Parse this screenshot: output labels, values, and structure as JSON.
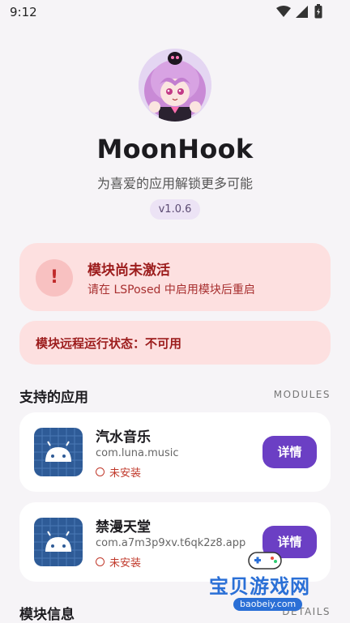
{
  "status_bar": {
    "time": "9:12"
  },
  "header": {
    "app_title": "MoonHook",
    "subtitle": "为喜爱的应用解锁更多可能",
    "version": "v1.0.6"
  },
  "warning": {
    "icon": "!",
    "title": "模块尚未激活",
    "description": "请在 LSPosed 中启用模块后重启"
  },
  "remote_status": {
    "text": "模块远程运行状态：不可用"
  },
  "supported_apps": {
    "title": "支持的应用",
    "tag": "MODULES",
    "apps": [
      {
        "name": "汽水音乐",
        "package": "com.luna.music",
        "status": "未安装",
        "button": "详情"
      },
      {
        "name": "禁漫天堂",
        "package": "com.a7m3p9xv.t6qk2z8.app",
        "status": "未安装",
        "button": "详情"
      }
    ]
  },
  "module_info": {
    "title": "模块信息",
    "tag": "DETAILS"
  },
  "watermark": {
    "text": "宝贝游戏网",
    "url": "baobeiy.com"
  },
  "colors": {
    "accent": "#6b3fc4",
    "warning_bg": "#fde0e0",
    "warning_text": "#9c1c1c",
    "background": "#f6f4f7"
  }
}
